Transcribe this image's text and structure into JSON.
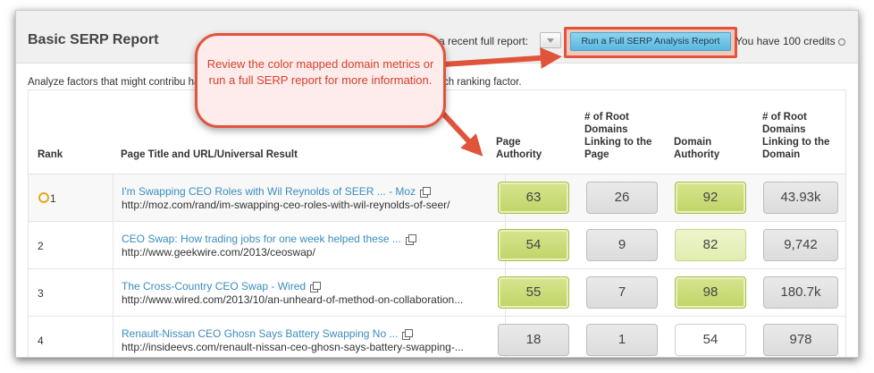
{
  "report": {
    "title": "Basic SERP Report",
    "recent_label": "a recent full report:",
    "run_button_label": "Run a Full SERP Analysis Report",
    "credits_text": "You have 100 credits",
    "analyze_text": "Analyze factors that might contribu                                                                                                    haded data points below indicate the leading URL for each ranking factor."
  },
  "callout": {
    "text": "Review the color mapped domain metrics or run a full SERP report for more information."
  },
  "table": {
    "headers": {
      "rank": "Rank",
      "page": "Page Title and URL/Universal Result",
      "page_authority": "Page Authority",
      "root_domains_page": "# of Root Domains Linking to the Page",
      "domain_authority": "Domain Authority",
      "root_domains_domain": "# of Root Domains Linking to the Domain"
    },
    "rows": [
      {
        "rank": "1",
        "title": "I'm Swapping CEO Roles with Wil Reynolds of SEER ... - Moz",
        "url": "http://moz.com/rand/im-swapping-ceo-roles-with-wil-reynolds-of-seer/",
        "page_authority": "63",
        "root_domains_page": "26",
        "domain_authority": "92",
        "root_domains_domain": "43.93k"
      },
      {
        "rank": "2",
        "title": "CEO Swap: How trading jobs for one week helped these ...",
        "url": "http://www.geekwire.com/2013/ceoswap/",
        "page_authority": "54",
        "root_domains_page": "9",
        "domain_authority": "82",
        "root_domains_domain": "9,742"
      },
      {
        "rank": "3",
        "title": "The Cross-Country CEO Swap - Wired",
        "url": "http://www.wired.com/2013/10/an-unheard-of-method-on-collaboration...",
        "page_authority": "55",
        "root_domains_page": "7",
        "domain_authority": "98",
        "root_domains_domain": "180.7k"
      },
      {
        "rank": "4",
        "title": "Renault-Nissan CEO Ghosn Says Battery Swapping No ...",
        "url": "http://insideevs.com/renault-nissan-ceo-ghosn-says-battery-swapping-...",
        "page_authority": "18",
        "root_domains_page": "1",
        "domain_authority": "54",
        "root_domains_domain": "978"
      }
    ]
  },
  "colors": {
    "accent_red": "#e1543c",
    "button_blue": "#56b7e0",
    "link_blue": "#3a8dc0",
    "metric_green": "#bfd467",
    "rank_ring": "#e8a81c"
  },
  "icons": [
    "dropdown-caret-icon",
    "info-icon",
    "copy-link-icon",
    "rank-ring-icon",
    "callout-arrow"
  ]
}
